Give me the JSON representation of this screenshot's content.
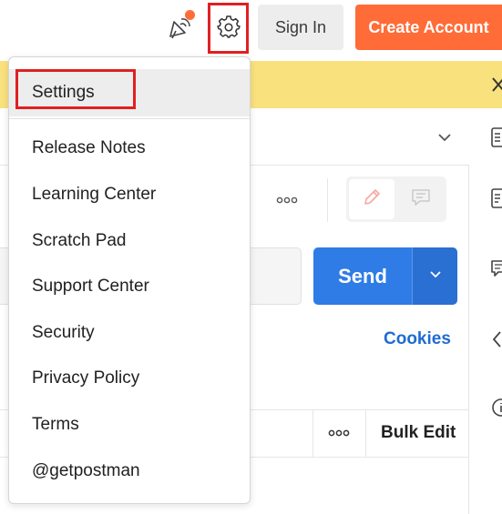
{
  "header": {
    "satellite_icon": "satellite-icon",
    "notification_color": "#ff6c37",
    "settings_icon": "gear-icon",
    "sign_in_label": "Sign In",
    "create_account_label": "Create Account",
    "brand_color": "#ff6c37"
  },
  "banner": {
    "color": "#f9e27e",
    "close_icon": "close-icon"
  },
  "settings_menu": {
    "items": [
      {
        "label": "Settings",
        "active": true
      },
      {
        "label": "Release Notes"
      },
      {
        "label": "Learning Center"
      },
      {
        "label": "Scratch Pad"
      },
      {
        "label": "Support Center"
      },
      {
        "label": "Security"
      },
      {
        "label": "Privacy Policy"
      },
      {
        "label": "Terms"
      },
      {
        "label": "@getpostman"
      }
    ]
  },
  "request": {
    "send_label": "Send",
    "send_color": "#2f7ce6",
    "cookies_label": "Cookies",
    "bulk_edit_label": "Bulk Edit"
  },
  "right_rail": {
    "icons": [
      "documentation-icon",
      "info-icon",
      "comments-icon",
      "code-icon",
      "info-circle-icon"
    ]
  }
}
